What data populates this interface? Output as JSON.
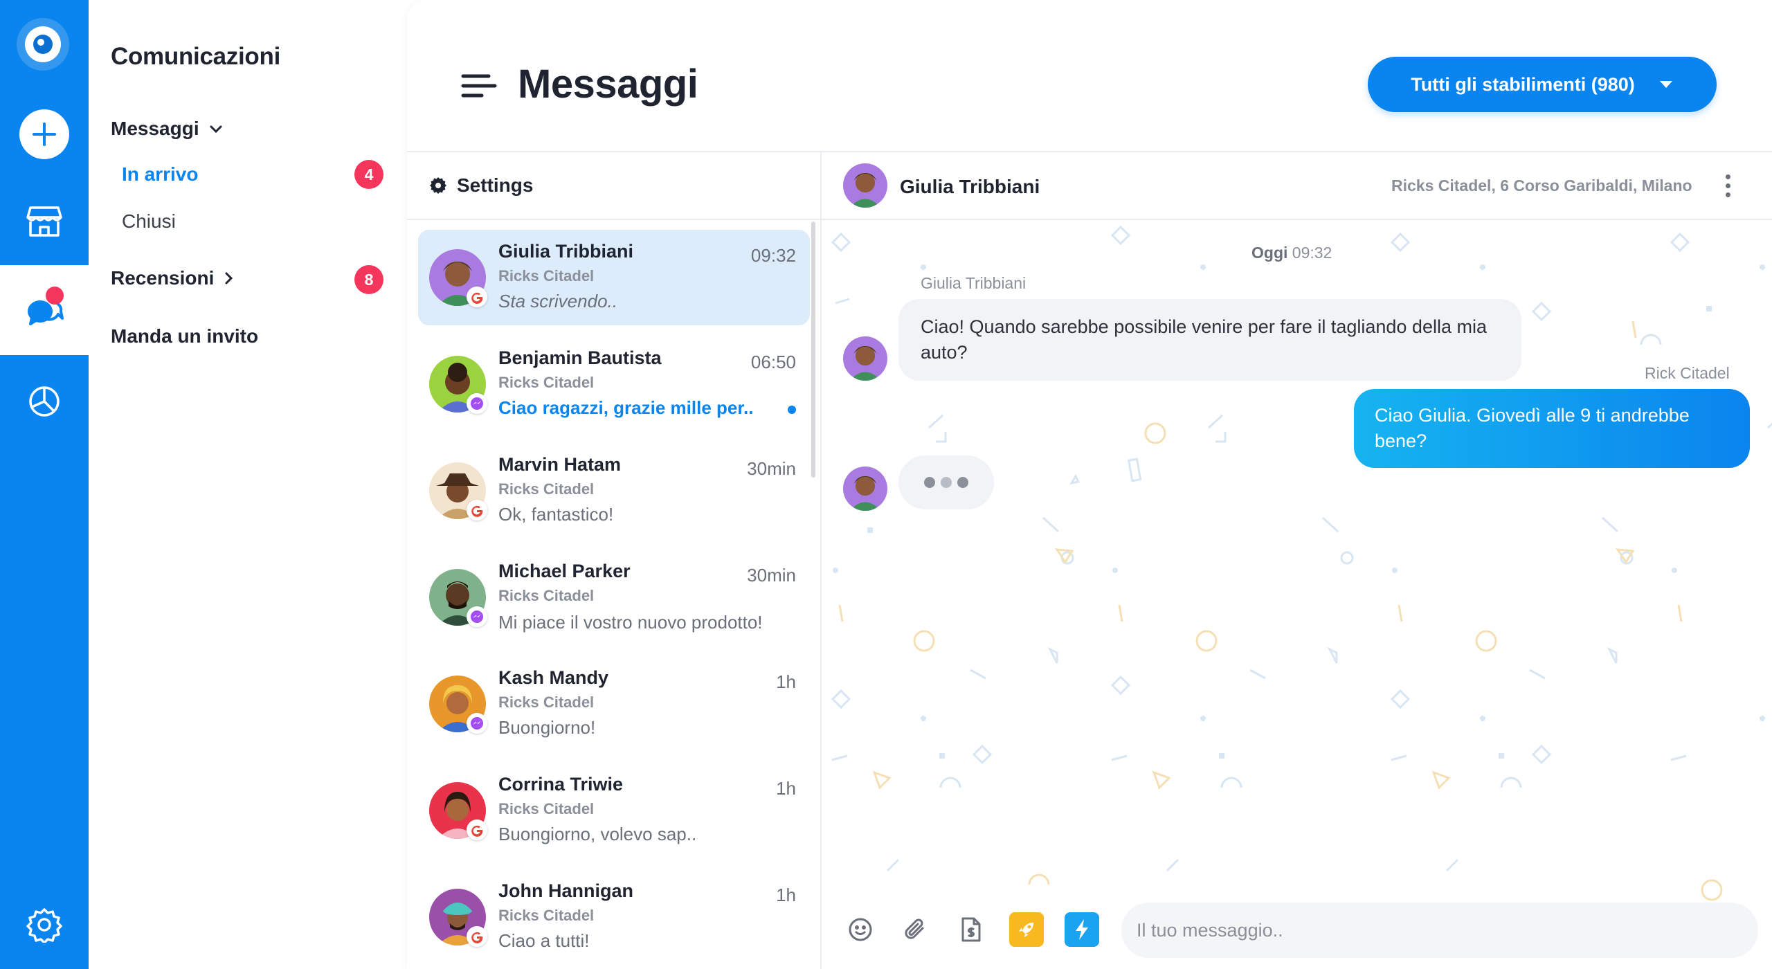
{
  "app": {
    "icons": {
      "logo": "eye-logo-icon",
      "add": "plus-icon",
      "store": "store-icon",
      "chat": "chat-bubbles-icon",
      "stats": "pie-chart-icon",
      "settings": "gear-icon"
    },
    "accent_color": "#0a84ee",
    "alert_color": "#f5365c"
  },
  "nav": {
    "title": "Comunicazioni",
    "messaggi_label": "Messaggi",
    "inarrivo_label": "In arrivo",
    "inarrivo_count": "4",
    "chiusi_label": "Chiusi",
    "recensioni_label": "Recensioni",
    "recensioni_count": "8",
    "invito_label": "Manda un invito"
  },
  "header": {
    "title": "Messaggi",
    "store_select": "Tutti gli stabilimenti (980)"
  },
  "list": {
    "settings_label": "Settings",
    "conversations": [
      {
        "name": "Giulia Tribbiani",
        "store": "Ricks Citadel",
        "message": "Sta scrivendo..",
        "time": "09:32",
        "source": "google",
        "active": true,
        "style": "italic"
      },
      {
        "name": "Benjamin Bautista",
        "store": "Ricks Citadel",
        "message": "Ciao ragazzi, grazie mille per..",
        "time": "06:50",
        "source": "messenger",
        "style": "unread"
      },
      {
        "name": "Marvin Hatam",
        "store": "Ricks Citadel",
        "message": "Ok, fantastico!",
        "time": "30min",
        "source": "google"
      },
      {
        "name": "Michael Parker",
        "store": "Ricks Citadel",
        "message": "Mi piace  il vostro nuovo prodotto!",
        "time": "30min",
        "source": "messenger"
      },
      {
        "name": "Kash Mandy",
        "store": "Ricks Citadel",
        "message": "Buongiorno!",
        "time": "1h",
        "source": "messenger"
      },
      {
        "name": "Corrina Triwie",
        "store": "Ricks Citadel",
        "message": "Buongiorno, volevo sap..",
        "time": "1h",
        "source": "google"
      },
      {
        "name": "John Hannigan",
        "store": "Ricks Citadel",
        "message": "Ciao a tutti!",
        "time": "1h",
        "source": "google"
      }
    ]
  },
  "chat": {
    "contact_name": "Giulia Tribbiani",
    "location": "Ricks Citadel, 6 Corso Garibaldi, Milano",
    "day_label": "Oggi",
    "day_time": "09:32",
    "incoming_sender": "Giulia Tribbiani",
    "incoming_text": "Ciao! Quando sarebbe possibile venire per fare il tagliando della mia auto?",
    "outgoing_sender": "Rick Citadel",
    "outgoing_text": "Ciao Giulia. Giovedì alle 9 ti andrebbe bene?",
    "input_placeholder": "Il tuo messaggio.."
  },
  "composer": {
    "icons": [
      "emoji-icon",
      "attachment-icon",
      "invoice-icon",
      "rocket-icon",
      "lightning-icon"
    ]
  }
}
